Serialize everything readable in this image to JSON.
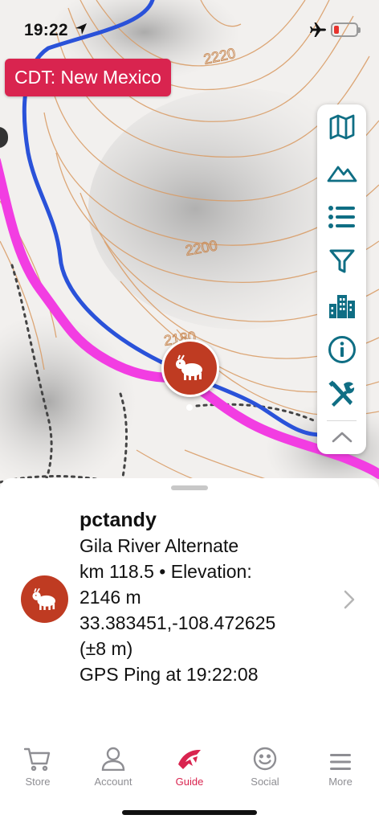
{
  "status_bar": {
    "time": "19:22",
    "icons": [
      "location-arrow-icon",
      "airplane-icon",
      "battery-icon"
    ],
    "battery_color": "#e7332d"
  },
  "map": {
    "trail_badge": "CDT: New Mexico",
    "contour_labels": [
      "2220",
      "2200",
      "2180"
    ],
    "trail_color": "#f23de2",
    "river_color": "#2a52d9",
    "toolbar": [
      "map-icon",
      "mountain-icon",
      "list-icon",
      "filter-icon",
      "buildings-icon",
      "info-icon",
      "tools-icon",
      "chevron-up-icon"
    ]
  },
  "sheet": {
    "user_name": "pctandy",
    "route_name": "Gila River Alternate",
    "km_elevation": "km 118.5 • Elevation:",
    "elevation_value": "2146 m",
    "coordinates": "33.383451,-108.472625",
    "accuracy": "(±8 m)",
    "ping": "GPS Ping at 19:22:08"
  },
  "tabs": [
    {
      "label": "Store",
      "icon": "cart-icon"
    },
    {
      "label": "Account",
      "icon": "person-icon"
    },
    {
      "label": "Guide",
      "icon": "guide-logo-icon",
      "active": true
    },
    {
      "label": "Social",
      "icon": "smiley-icon"
    },
    {
      "label": "More",
      "icon": "menu-icon"
    }
  ],
  "colors": {
    "accent": "#d9244f",
    "icon_teal": "#0f6e84",
    "avatar": "#bf3b22"
  }
}
